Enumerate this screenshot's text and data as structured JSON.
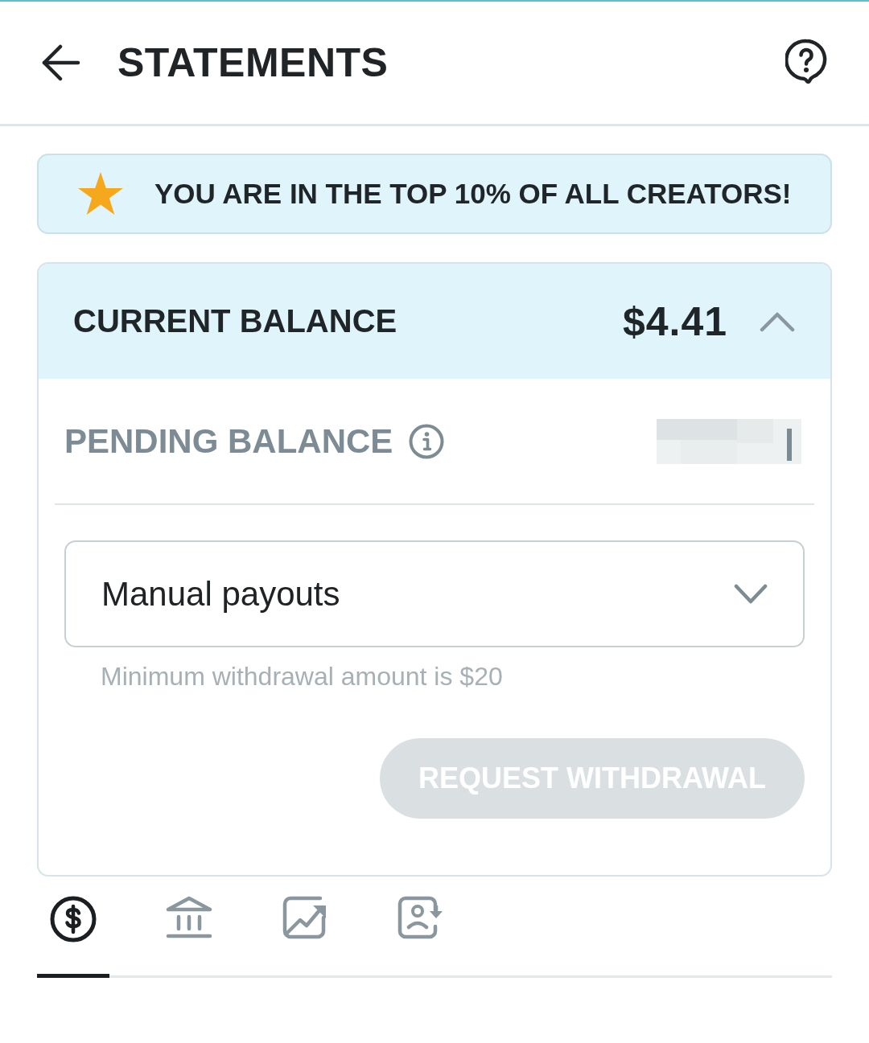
{
  "header": {
    "title": "STATEMENTS"
  },
  "banner": {
    "text": "YOU ARE IN THE TOP 10% OF ALL CREATORS!"
  },
  "balance_card": {
    "title": "CURRENT BALANCE",
    "amount": "$4.41",
    "expanded": true,
    "pending_label": "PENDING BALANCE",
    "payout_method": {
      "value": "Manual payouts"
    },
    "hint": "Minimum withdrawal amount is $20",
    "button": {
      "label": "REQUEST WITHDRAWAL",
      "disabled": true
    }
  },
  "tabs": [
    {
      "kind": "dollar",
      "selected": true
    },
    {
      "kind": "bank",
      "selected": false
    },
    {
      "kind": "chart",
      "selected": false
    },
    {
      "kind": "profile",
      "selected": false
    }
  ]
}
